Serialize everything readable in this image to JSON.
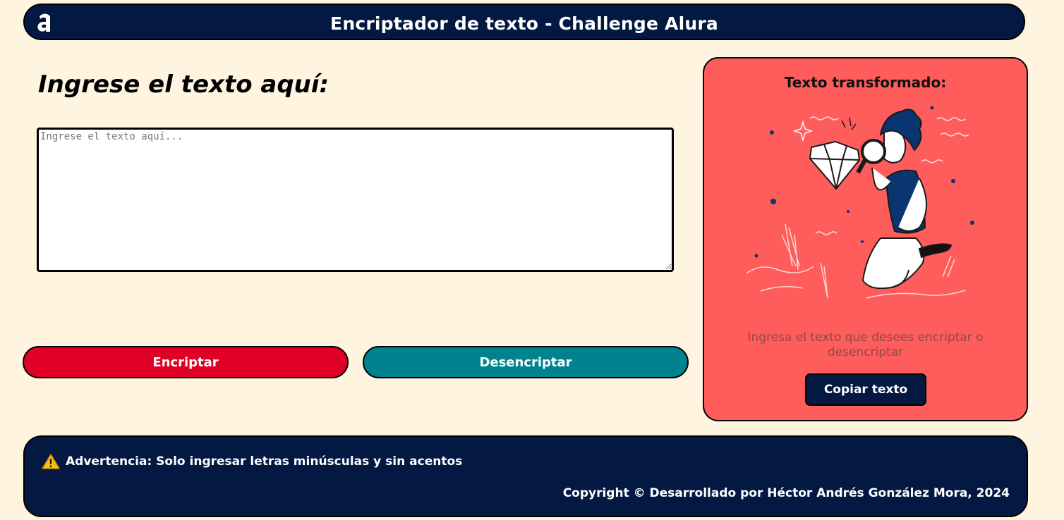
{
  "header": {
    "title": "Encriptador de texto - Challenge Alura",
    "logo_letter": "a"
  },
  "main": {
    "title": "Ingrese el texto aquí:",
    "input_placeholder": "Ingrese el texto aquí...",
    "input_value": "",
    "encrypt_label": "Encriptar",
    "decrypt_label": "Desencriptar"
  },
  "output": {
    "title": "Texto transformado:",
    "message": "Ingresa el texto que desees encriptar o desencriptar",
    "copy_label": "Copiar texto",
    "illustration": "person-with-magnifying-glass-looking-at-diamond"
  },
  "footer": {
    "warning_icon": "warning-icon",
    "warning_text": "Advertencia: Solo ingresar letras minúsculas y sin acentos",
    "copyright": "Copyright © Desarrollado por Héctor Andrés González Mora, 2024"
  },
  "colors": {
    "background": "#fff4e0",
    "navy": "#031942",
    "encrypt": "#e00025",
    "decrypt": "#00838f",
    "panel": "#ff5c5c"
  }
}
